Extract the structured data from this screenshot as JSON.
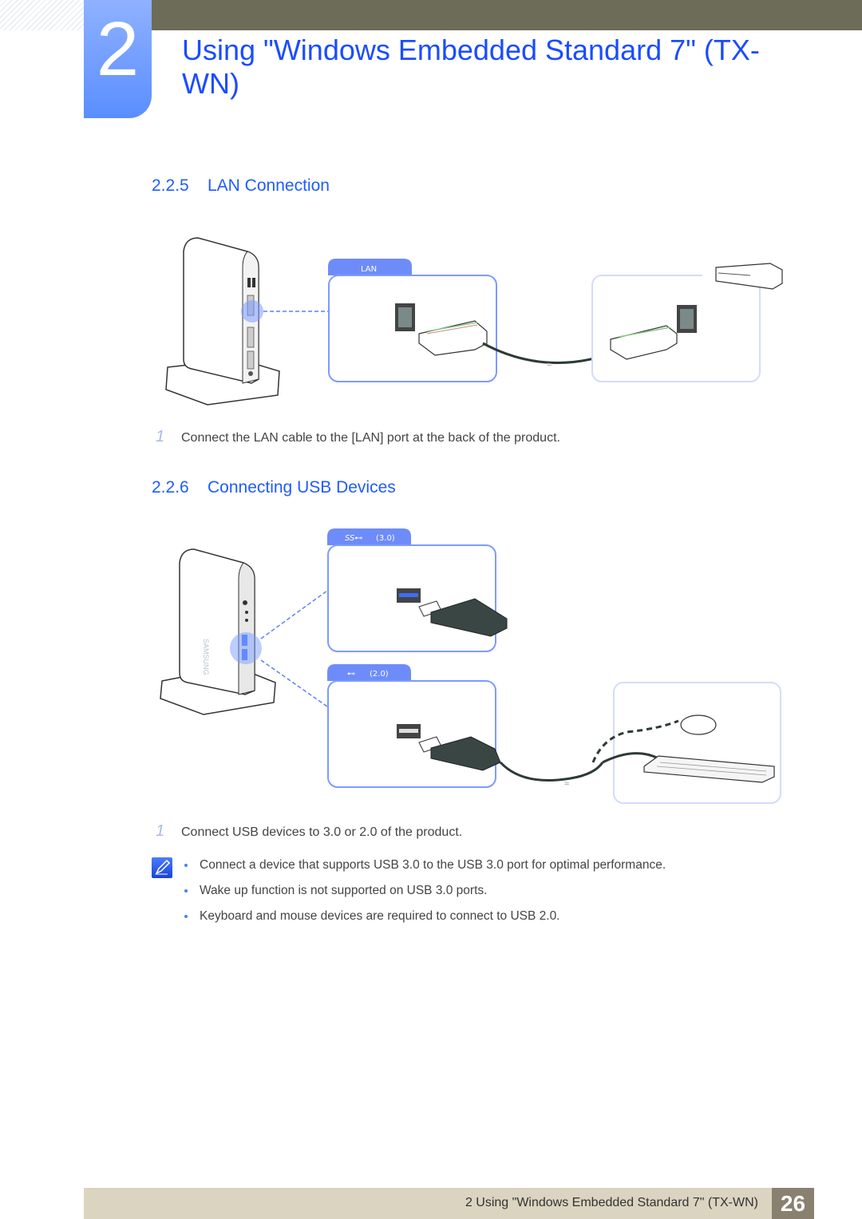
{
  "chapter": {
    "number": "2",
    "title": "Using \"Windows Embedded Standard 7\" (TX-WN)"
  },
  "sections": [
    {
      "number": "2.2.5",
      "title": "LAN Connection",
      "figure": {
        "port_tab_label": "LAN",
        "illustration": "product-side-lan-port-to-network-device"
      },
      "steps": [
        {
          "num": "1",
          "text": "Connect the LAN cable to the [LAN] port at the back of the product."
        }
      ]
    },
    {
      "number": "2.2.6",
      "title": "Connecting USB Devices",
      "figure": {
        "usb3_tab_label": "(3.0)",
        "usb3_icon": "superspeed-usb-icon",
        "usb2_tab_label": "(2.0)",
        "usb2_icon": "usb-icon",
        "brand_text": "SAMSUNG"
      },
      "steps": [
        {
          "num": "1",
          "text": "Connect USB devices to 3.0 or 2.0 of the product."
        }
      ],
      "notes": [
        "Connect a device that supports USB 3.0 to the USB 3.0 port for optimal performance.",
        "Wake up function is not supported on USB 3.0 ports.",
        "Keyboard and mouse devices are required to connect to USB 2.0."
      ]
    }
  ],
  "footer": {
    "text": "2 Using \"Windows Embedded Standard 7\" (TX-WN)",
    "page_number": "26"
  },
  "colors": {
    "accent": "#1f5bff",
    "top_bar": "#6d6c58",
    "footer_bar": "#dad4c0",
    "page_badge": "#8a8070",
    "panel_border": "#7d9bff"
  }
}
